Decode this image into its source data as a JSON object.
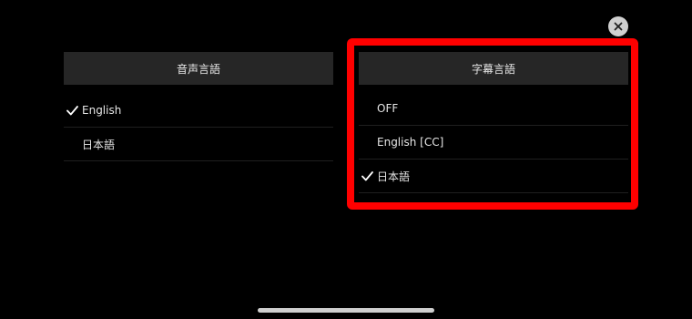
{
  "close_button": {
    "icon": "close-icon"
  },
  "audio_panel": {
    "title": "音声言語",
    "options": [
      {
        "label": "English",
        "selected": true
      },
      {
        "label": "日本語",
        "selected": false
      }
    ]
  },
  "subtitle_panel": {
    "title": "字幕言語",
    "options": [
      {
        "label": "OFF",
        "selected": false
      },
      {
        "label": "English [CC]",
        "selected": false
      },
      {
        "label": "日本語",
        "selected": true
      }
    ]
  },
  "colors": {
    "background": "#000000",
    "header_bg": "#262626",
    "highlight": "#ff0000",
    "close_button_bg": "#d0d0d0"
  }
}
